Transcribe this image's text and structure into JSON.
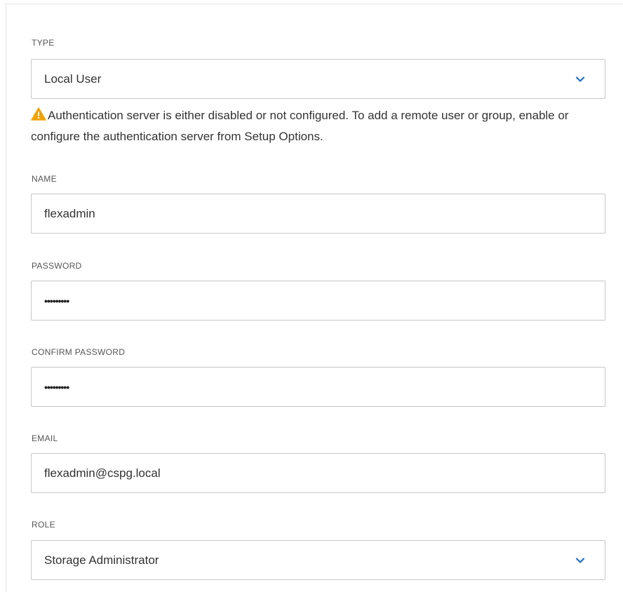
{
  "form": {
    "type": {
      "label": "TYPE",
      "value": "Local User"
    },
    "warning": {
      "text": "Authentication server is either disabled or not configured. To add a remote user or group, enable or configure the authentication server from Setup Options."
    },
    "name": {
      "label": "NAME",
      "value": "flexadmin"
    },
    "password": {
      "label": "PASSWORD",
      "masked_value": "•••••••••"
    },
    "confirm_password": {
      "label": "CONFIRM PASSWORD",
      "masked_value": "•••••••••"
    },
    "email": {
      "label": "EMAIL",
      "value": "flexadmin@cspg.local"
    },
    "role": {
      "label": "ROLE",
      "value": "Storage Administrator"
    }
  },
  "icons": {
    "dropdown": "chevron-down-icon",
    "warning": "warning-triangle-icon"
  },
  "colors": {
    "chevron": "#1f6fd1",
    "warning": "#f0a30a",
    "border": "#c7c7c7",
    "label": "#555555",
    "text": "#333333"
  }
}
